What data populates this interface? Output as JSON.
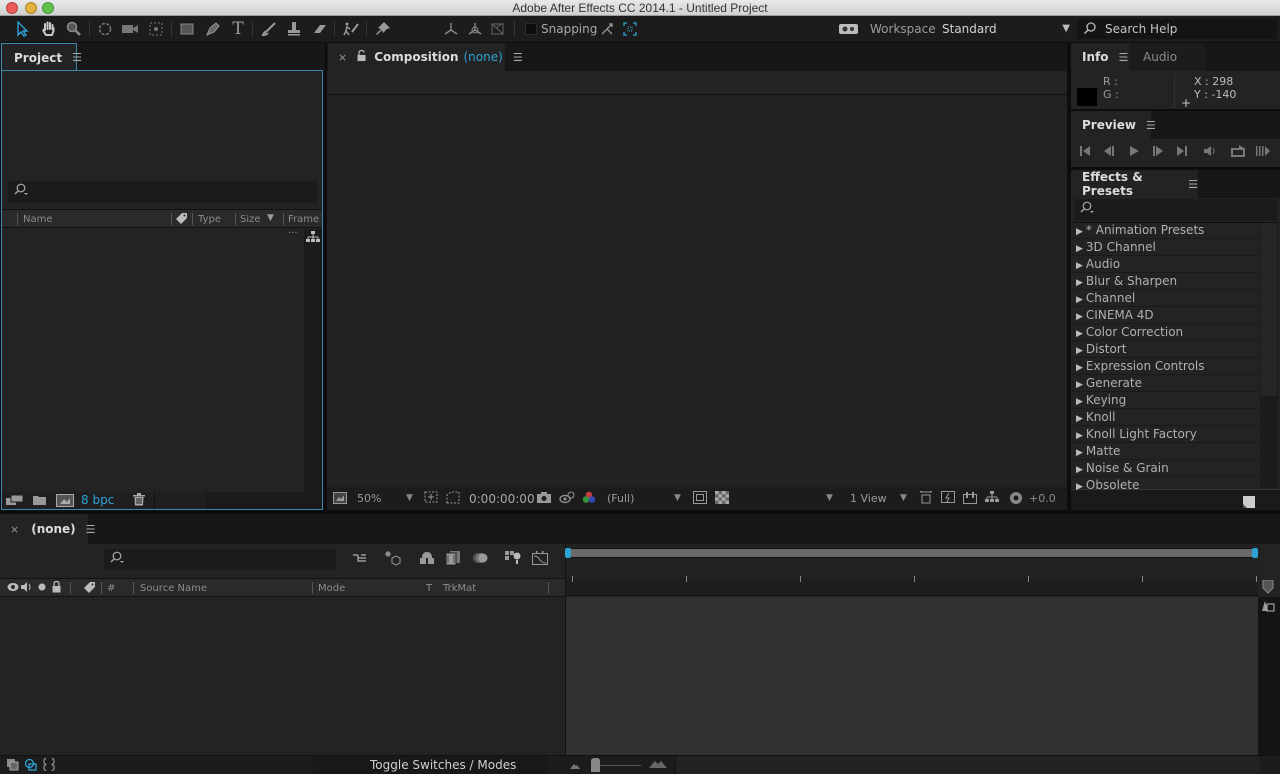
{
  "window": {
    "title": "Adobe After Effects CC 2014.1 - Untitled Project",
    "traffic_lights": [
      "close",
      "minimize",
      "zoom"
    ]
  },
  "toolbar": {
    "tools": [
      {
        "name": "selection-tool",
        "glyph": "➚"
      },
      {
        "name": "hand-tool",
        "glyph": "✋"
      },
      {
        "name": "zoom-tool",
        "glyph": "🔍"
      },
      {
        "name": "rotation-tool",
        "glyph": "↻"
      },
      {
        "name": "camera-tool",
        "glyph": "▰"
      },
      {
        "name": "pan-behind-tool",
        "glyph": "⬚"
      },
      {
        "name": "rectangle-tool",
        "glyph": "■"
      },
      {
        "name": "pen-tool",
        "glyph": "✒"
      },
      {
        "name": "type-tool",
        "glyph": "T"
      },
      {
        "name": "brush-tool",
        "glyph": "⁄"
      },
      {
        "name": "clone-stamp-tool",
        "glyph": "⊥"
      },
      {
        "name": "eraser-tool",
        "glyph": "▱"
      },
      {
        "name": "roto-brush-tool",
        "glyph": "⚲"
      },
      {
        "name": "puppet-pin-tool",
        "glyph": "✚"
      },
      {
        "name": "local-axis-mode",
        "glyph": "⅄"
      },
      {
        "name": "world-axis-mode",
        "glyph": "⅄"
      },
      {
        "name": "view-axis-mode",
        "glyph": "⊠"
      }
    ],
    "snapping_label": "Snapping",
    "workspace_label": "Workspace:",
    "workspace_value": "Standard",
    "search_help_label": "Search Help"
  },
  "project_panel": {
    "tab_label": "Project",
    "search_placeholder": "",
    "columns": [
      "Name",
      "Type",
      "Size",
      "Frame ..."
    ],
    "items": [],
    "bpc_label": "8 bpc"
  },
  "composition_panel": {
    "tab_prefix": "Composition",
    "tab_comp": "(none)",
    "magnification": "50%",
    "timecode": "0:00:00:00",
    "resolution": "(Full)",
    "view_layout": "1 View",
    "exposure": "+0.0"
  },
  "info_panel": {
    "tab_label": "Info",
    "audio_tab_label": "Audio",
    "r_label": "R :",
    "g_label": "G :",
    "x_readout": "X : 298",
    "y_readout": "Y : -140"
  },
  "preview_panel": {
    "tab_label": "Preview",
    "controls": [
      "first-frame",
      "previous-frame",
      "play",
      "next-frame",
      "last-frame",
      "mute-audio",
      "loop",
      "ram-preview"
    ]
  },
  "effects_panel": {
    "tab_label": "Effects & Presets",
    "search_placeholder": "",
    "categories": [
      "* Animation Presets",
      "3D Channel",
      "Audio",
      "Blur & Sharpen",
      "Channel",
      "CINEMA 4D",
      "Color Correction",
      "Distort",
      "Expression Controls",
      "Generate",
      "Keying",
      "Knoll",
      "Knoll Light Factory",
      "Matte",
      "Noise & Grain",
      "Obsolete"
    ]
  },
  "timeline_panel": {
    "tab_label": "(none)",
    "search_placeholder": "",
    "columns": [
      "#",
      "Source Name",
      "Mode",
      "T",
      "TrkMat"
    ],
    "toggle_label": "Toggle Switches / Modes"
  },
  "colors": {
    "accent": "#2fa3d6",
    "panel_bg": "#232323",
    "app_bg": "#0d0d0d"
  }
}
